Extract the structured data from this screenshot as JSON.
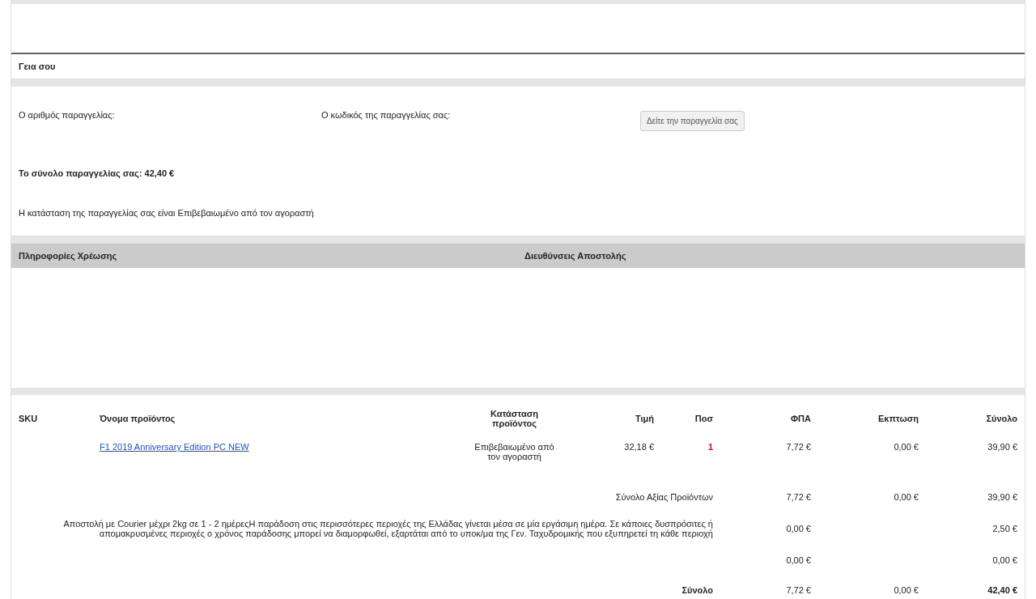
{
  "greeting": "Γεια σου",
  "order_info": {
    "number_label": "Ο αριθμός παραγγελίας:",
    "code_label": "Ο κωδικός της παραγγελίας σας:",
    "view_button": "Δείτε την παραγγελία σας",
    "total": "Το σύνολο παραγγελίας σας: 42,40 €",
    "status": "Η κατάσταση της παραγγελίας σας είναι Επιβεβαιωμένο από τον αγοραστή"
  },
  "addresses": {
    "billing_heading": "Πληροφορίες Χρέωσης",
    "shipping_heading": "Διευθύνσεις Αποστολής"
  },
  "items": {
    "columns": [
      "SKU",
      "Όνομα προϊόντος",
      "Κατάσταση προϊόντος",
      "Τιμή",
      "Ποσ",
      "ΦΠΑ",
      "Εκπτωση",
      "Σύνολο"
    ],
    "rows": [
      {
        "name": "F1 2019 Anniversary Edition PC NEW",
        "status": "Επιβεβαιωμένο από τον αγοραστή",
        "price": "32,18 €",
        "qty": "1",
        "vat": "7,72 €",
        "discount": "0,00 €",
        "total": "39,90 €"
      }
    ]
  },
  "summary": [
    {
      "kind": "subtotal",
      "label": "Σύνολο Αξίας Προϊόντων",
      "vat": "7,72 €",
      "discount": "0,00 €",
      "total": "39,90 €"
    },
    {
      "kind": "shipping",
      "label": "Αποστολή με Courier μέχρι 2kg σε 1 - 2 ημέρεςΗ παράδοση στις περισσότερες περιοχές της Ελλάδας γίνεται μέσα σε μία εργάσιμη ημέρα. Σε κάποιες δυσπρόσιτες ή απομακρυσμένες περιοχές ο χρόνος παράδοσης μπορεί να διαμορφωθεί, εξαρτάται από το υποκ/μα της Γεν. Ταχυδρομικής που εξυπηρετεί τη κάθε περιοχή",
      "vat": "0,00 €",
      "total": "2,50 €"
    },
    {
      "kind": "other",
      "vat": "0,00 €",
      "total": "0,00 €"
    },
    {
      "kind": "grand",
      "label": "Σύνολο",
      "vat": "7,72 €",
      "discount": "0,00 €",
      "total": "42,40 €"
    }
  ]
}
